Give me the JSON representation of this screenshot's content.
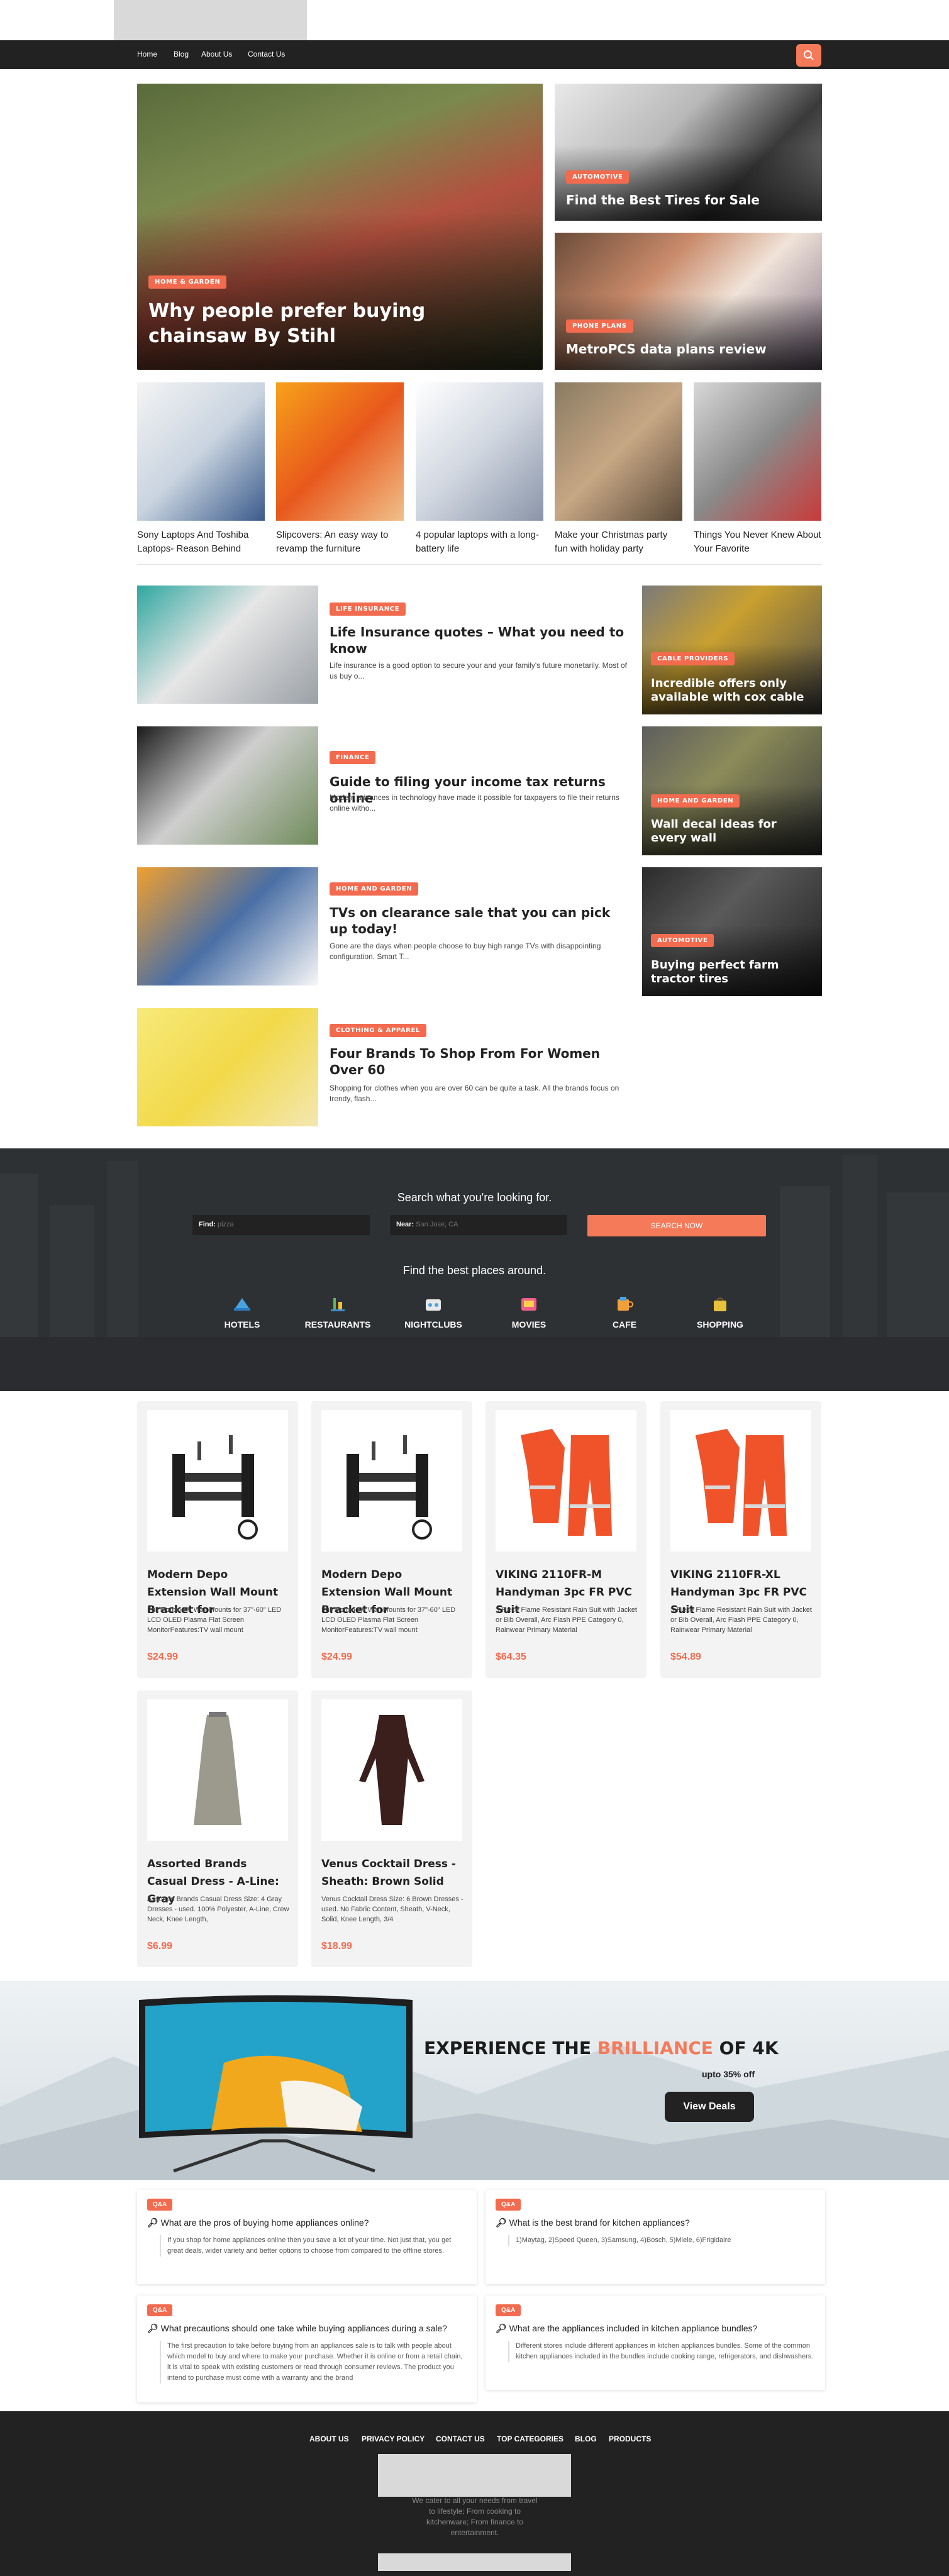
{
  "nav": {
    "items": [
      "Home",
      "Blog",
      "About Us",
      "Contact Us"
    ]
  },
  "hero": {
    "main": {
      "tag": "HOME & GARDEN",
      "title": "Why people prefer buying chainsaw By Stihl"
    },
    "side": [
      {
        "tag": "AUTOMOTIVE",
        "title": "Find the Best Tires for Sale"
      },
      {
        "tag": "PHONE PLANS",
        "title": "MetroPCS data plans review"
      }
    ]
  },
  "thumbs": [
    "Sony Laptops And Toshiba Laptops- Reason Behind",
    "Slipcovers: An easy way to revamp the furniture",
    "4 popular laptops with a long-battery life",
    "Make your Christmas party fun with holiday party",
    "Things You Never Knew About Your Favorite"
  ],
  "articles": [
    {
      "tag": "LIFE INSURANCE",
      "title": "Life Insurance quotes – What you need to know",
      "excerpt": "Life insurance is a good option to secure your and your family's future monetarily. Most of us buy o..."
    },
    {
      "tag": "FINANCE",
      "title": "Guide to filing your income tax returns online",
      "excerpt": "Modern advances in technology have made it possible for taxpayers to file their returns online witho..."
    },
    {
      "tag": "HOME AND GARDEN",
      "title": "TVs on clearance sale that you can pick up today!",
      "excerpt": "Gone are the days when people choose to buy high range TVs with disappointing configuration. Smart T..."
    },
    {
      "tag": "CLOTHING & APPAREL",
      "title": "Four Brands To Shop From For Women Over 60",
      "excerpt": "Shopping for clothes when you are over 60 can be quite a task. All the brands focus on trendy, flash..."
    }
  ],
  "side_cards": [
    {
      "tag": "CABLE PROVIDERS",
      "title": "Incredible offers only available with cox cable"
    },
    {
      "tag": "HOME AND GARDEN",
      "title": "Wall decal ideas for every wall"
    },
    {
      "tag": "AUTOMOTIVE",
      "title": "Buying perfect farm tractor tires"
    }
  ],
  "finder": {
    "heading": "Search what you're looking for.",
    "find_label": "Find:",
    "find_placeholder": "pizza",
    "near_label": "Near:",
    "near_placeholder": "San Jose, CA",
    "search_button": "SEARCH NOW",
    "subheading": "Find the best places around.",
    "categories": [
      "HOTELS",
      "RESTAURANTS",
      "NIGHTCLUBS",
      "MOVIES",
      "CAFE",
      "SHOPPING"
    ]
  },
  "products": [
    {
      "title": "Modern Depo Extension Wall Mount Bracket for",
      "desc": "Full Motion TV Wall Mounts for 37\"-60\" LED LCD OLED Plasma Flat Screen MonitorFeatures:TV wall mount",
      "price": "$24.99"
    },
    {
      "title": "Modern Depo Extension Wall Mount Bracket for",
      "desc": "Full Motion TV Wall Mounts for 37\"-60\" LED LCD OLED Plasma Flat Screen MonitorFeatures:TV wall mount",
      "price": "$24.99"
    },
    {
      "title": "VIKING 2110FR-M Handyman 3pc FR PVC Suit",
      "desc": "3-Piece Flame Resistant Rain Suit with Jacket or Bib Overall, Arc Flash PPE Category 0, Rainwear Primary Material",
      "price": "$64.35"
    },
    {
      "title": "VIKING 2110FR-XL Handyman 3pc FR PVC Suit",
      "desc": "3-Piece Flame Resistant Rain Suit with Jacket or Bib Overall, Arc Flash PPE Category 0, Rainwear Primary Material",
      "price": "$54.89"
    },
    {
      "title": "Assorted Brands Casual Dress - A-Line: Gray",
      "desc": "Assorted Brands Casual Dress Size: 4 Gray Dresses - used. 100% Polyester, A-Line, Crew Neck, Knee Length,",
      "price": "$6.99"
    },
    {
      "title": "Venus Cocktail Dress - Sheath: Brown Solid",
      "desc": "Venus Cocktail Dress Size: 6 Brown Dresses - used. No Fabric Content, Sheath, V-Neck, Solid, Knee Length, 3/4",
      "price": "$18.99"
    }
  ],
  "promo": {
    "title_pre": "EXPERIENCE THE ",
    "title_accent": "BRILLIANCE",
    "title_post": " OF 4K",
    "discount": "upto 35% off",
    "button": "View Deals"
  },
  "qa": [
    {
      "tag": "Q&A",
      "question": "What are the pros of buying home appliances online?",
      "answer": "If you shop for home appliances online then you save a lot of your time. Not just that, you get great deals, wider variety and better options to choose from compared to the offline stores."
    },
    {
      "tag": "Q&A",
      "question": "What is the best brand for kitchen appliances?",
      "answer": "1)Maytag, 2)Speed Queen, 3)Samsung, 4)Bosch, 5)Miele, 6)Frigidaire"
    },
    {
      "tag": "Q&A",
      "question": "What precautions should one take while buying appliances during a sale?",
      "answer": "The first precaution to take before buying from an appliances sale is to talk with people about which model to buy and where to make your purchase. Whether it is online or from a retail chain, it is vital to speak with existing customers or read through consumer reviews. The product you intend to purchase must come with a warranty and the brand"
    },
    {
      "tag": "Q&A",
      "question": "What are the appliances included in kitchen appliance bundles?",
      "answer": "Different stores include different appliances in kitchen appliances bundles. Some of the common kitchen appliances included in the bundles include cooking range, refrigerators, and dishwashers."
    }
  ],
  "footer": {
    "links": [
      "ABOUT US",
      "PRIVACY POLICY",
      "CONTACT US",
      "TOP CATEGORIES",
      "BLOG",
      "PRODUCTS"
    ],
    "tagline": "We cater to all your needs from travel to lifestyle; From cooking to kitchenware; From finance to entertainment."
  },
  "colors": {
    "accent": "#f26b4f",
    "dark": "#222222"
  }
}
